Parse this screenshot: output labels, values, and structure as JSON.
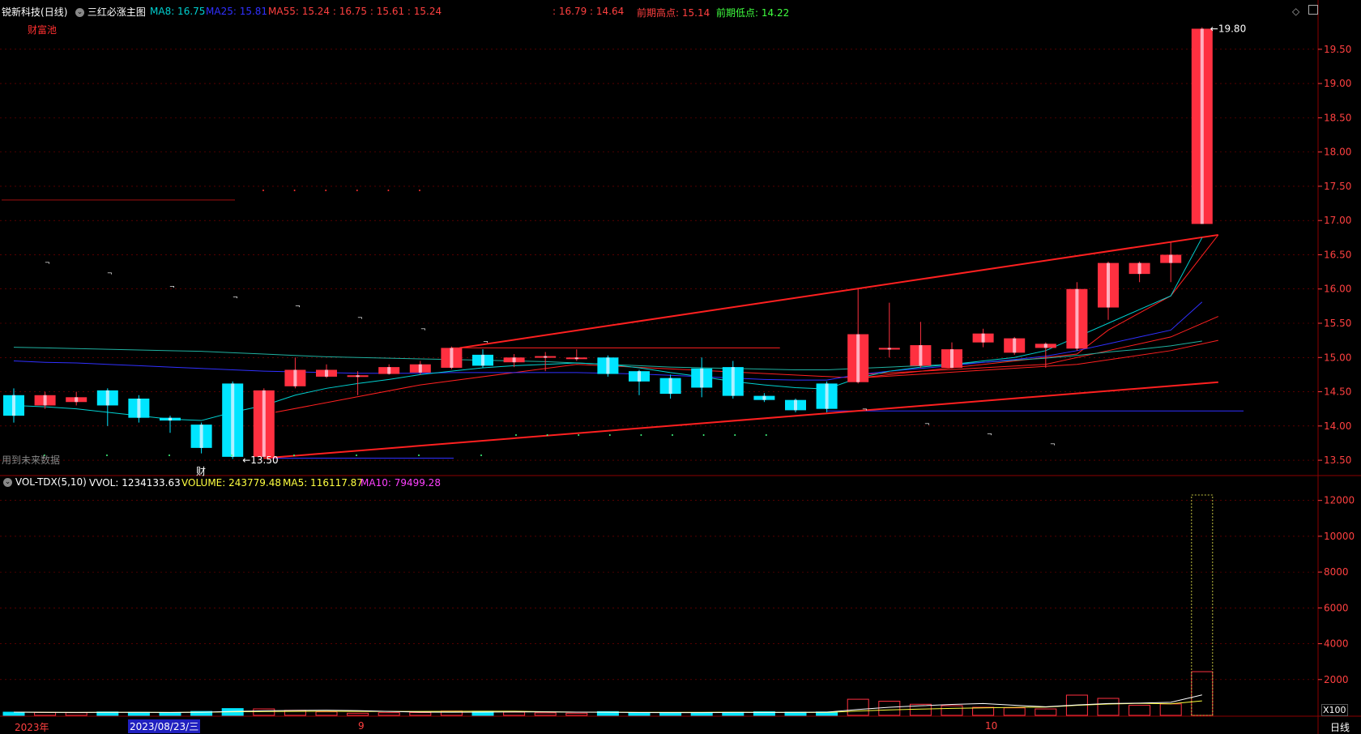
{
  "header": {
    "stock_name": "锐新科技",
    "period": "(日线)",
    "indicator_name": "三红必涨主图",
    "ma8": "MA8: 16.75",
    "ma25": "MA25: 15.81",
    "ma55": "MA55: 15.24 : 16.75 : 15.61 : 15.24",
    "range": ": 16.79 : 14.64",
    "prev_high": "前期高点: 15.14",
    "prev_low": "前期低点: 14.22",
    "caifu": "财富池",
    "future_data": "用到未来数据",
    "cai_marker": "财"
  },
  "volume_header": {
    "name": "VOL-TDX(5,10)",
    "vvol": "VVOL: 1234133.63",
    "volume": "VOLUME: 243779.48",
    "ma5": "MA5: 116117.87",
    "ma10": "MA10: 79499.28"
  },
  "footer": {
    "year_label": "2023年",
    "cursor_date": "2023/08/23/三",
    "month9": "9",
    "month10": "10",
    "period_button": "日线",
    "volume_unit": "X100"
  },
  "annotations": {
    "max_label": "19.80",
    "min_label": "13.50"
  },
  "colors": {
    "up": "#ff3040",
    "down": "#00e5ff",
    "ma8": "#00d0d0",
    "ma25": "#3030ff",
    "ma55": "#20b0a0",
    "grid": "#8b0000",
    "axis_text": "#ff4040",
    "trend": "#ff2020",
    "vol_ma5": "#ffffff",
    "vol_ma10": "#ffff40"
  },
  "chart_data": {
    "type": "candlestick",
    "price_ylim": [
      13.3,
      19.9
    ],
    "price_ticks": [
      "13.50",
      "14.00",
      "14.50",
      "15.00",
      "15.50",
      "16.00",
      "16.50",
      "17.00",
      "17.50",
      "18.00",
      "18.50",
      "19.00",
      "19.50"
    ],
    "volume_ylim": [
      0,
      12800
    ],
    "volume_ticks": [
      "2000",
      "4000",
      "6000",
      "8000",
      "10000",
      "12000"
    ],
    "candles": [
      {
        "o": 14.45,
        "c": 14.15,
        "h": 14.55,
        "l": 14.05,
        "v": 180
      },
      {
        "o": 14.3,
        "c": 14.45,
        "h": 14.5,
        "l": 14.25,
        "v": 160
      },
      {
        "o": 14.35,
        "c": 14.42,
        "h": 14.5,
        "l": 14.3,
        "v": 150
      },
      {
        "o": 14.52,
        "c": 14.3,
        "h": 14.55,
        "l": 14.0,
        "v": 190
      },
      {
        "o": 14.4,
        "c": 14.12,
        "h": 14.45,
        "l": 14.05,
        "v": 170
      },
      {
        "o": 14.12,
        "c": 14.08,
        "h": 14.15,
        "l": 13.9,
        "v": 140
      },
      {
        "o": 14.02,
        "c": 13.68,
        "h": 14.05,
        "l": 13.6,
        "v": 220
      },
      {
        "o": 14.62,
        "c": 13.55,
        "h": 14.65,
        "l": 13.52,
        "v": 380
      },
      {
        "o": 13.55,
        "c": 14.52,
        "h": 14.55,
        "l": 13.52,
        "v": 360
      },
      {
        "o": 14.58,
        "c": 14.82,
        "h": 15.0,
        "l": 14.55,
        "v": 280
      },
      {
        "o": 14.72,
        "c": 14.82,
        "h": 14.9,
        "l": 14.7,
        "v": 200
      },
      {
        "o": 14.72,
        "c": 14.74,
        "h": 14.8,
        "l": 14.45,
        "v": 120
      },
      {
        "o": 14.76,
        "c": 14.86,
        "h": 14.9,
        "l": 14.75,
        "v": 150
      },
      {
        "o": 14.78,
        "c": 14.9,
        "h": 14.95,
        "l": 14.75,
        "v": 160
      },
      {
        "o": 14.85,
        "c": 15.14,
        "h": 15.16,
        "l": 14.83,
        "v": 240
      },
      {
        "o": 15.04,
        "c": 14.88,
        "h": 15.12,
        "l": 14.85,
        "v": 230
      },
      {
        "o": 14.93,
        "c": 15.0,
        "h": 15.05,
        "l": 14.86,
        "v": 180
      },
      {
        "o": 15.0,
        "c": 15.02,
        "h": 15.08,
        "l": 14.8,
        "v": 140
      },
      {
        "o": 14.98,
        "c": 15.0,
        "h": 15.12,
        "l": 14.95,
        "v": 120
      },
      {
        "o": 15.0,
        "c": 14.76,
        "h": 15.03,
        "l": 14.72,
        "v": 210
      },
      {
        "o": 14.8,
        "c": 14.65,
        "h": 14.82,
        "l": 14.45,
        "v": 150
      },
      {
        "o": 14.7,
        "c": 14.47,
        "h": 14.75,
        "l": 14.4,
        "v": 130
      },
      {
        "o": 14.84,
        "c": 14.56,
        "h": 15.0,
        "l": 14.42,
        "v": 160
      },
      {
        "o": 14.86,
        "c": 14.44,
        "h": 14.95,
        "l": 14.4,
        "v": 170
      },
      {
        "o": 14.44,
        "c": 14.38,
        "h": 14.48,
        "l": 14.35,
        "v": 200
      },
      {
        "o": 14.38,
        "c": 14.23,
        "h": 14.4,
        "l": 14.2,
        "v": 180
      },
      {
        "o": 14.62,
        "c": 14.25,
        "h": 14.65,
        "l": 14.2,
        "v": 190
      },
      {
        "o": 14.64,
        "c": 15.34,
        "h": 16.0,
        "l": 14.62,
        "v": 900
      },
      {
        "o": 15.12,
        "c": 15.14,
        "h": 15.8,
        "l": 15.0,
        "v": 790
      },
      {
        "o": 14.88,
        "c": 15.18,
        "h": 15.52,
        "l": 14.85,
        "v": 620
      },
      {
        "o": 14.85,
        "c": 15.12,
        "h": 15.22,
        "l": 14.84,
        "v": 540
      },
      {
        "o": 15.22,
        "c": 15.35,
        "h": 15.42,
        "l": 15.15,
        "v": 450
      },
      {
        "o": 15.07,
        "c": 15.28,
        "h": 15.3,
        "l": 15.04,
        "v": 420
      },
      {
        "o": 15.14,
        "c": 15.2,
        "h": 15.22,
        "l": 14.85,
        "v": 360
      },
      {
        "o": 15.13,
        "c": 16.0,
        "h": 16.1,
        "l": 15.1,
        "v": 1130
      },
      {
        "o": 15.73,
        "c": 16.38,
        "h": 16.4,
        "l": 15.55,
        "v": 950
      },
      {
        "o": 16.22,
        "c": 16.38,
        "h": 16.4,
        "l": 16.1,
        "v": 560
      },
      {
        "o": 16.38,
        "c": 16.5,
        "h": 16.68,
        "l": 16.1,
        "v": 640
      },
      {
        "o": 16.95,
        "c": 19.8,
        "h": 19.82,
        "l": 16.95,
        "v": 2440
      }
    ],
    "volume_ghost": 12300,
    "ma8": [
      14.3,
      14.28,
      14.25,
      14.2,
      14.15,
      14.1,
      14.08,
      14.2,
      14.3,
      14.45,
      14.55,
      14.62,
      14.68,
      14.75,
      14.8,
      14.85,
      14.88,
      14.9,
      14.92,
      14.9,
      14.85,
      14.78,
      14.72,
      14.65,
      14.6,
      14.56,
      14.54,
      14.7,
      14.8,
      14.86,
      14.9,
      14.95,
      15.0,
      15.1,
      15.3,
      15.5,
      15.7,
      15.9,
      16.75
    ],
    "ma25": [
      14.95,
      14.93,
      14.92,
      14.9,
      14.88,
      14.86,
      14.84,
      14.82,
      14.8,
      14.79,
      14.78,
      14.77,
      14.77,
      14.77,
      14.78,
      14.78,
      14.78,
      14.78,
      14.78,
      14.77,
      14.76,
      14.74,
      14.72,
      14.7,
      14.68,
      14.67,
      14.67,
      14.75,
      14.8,
      14.84,
      14.88,
      14.93,
      14.97,
      15.02,
      15.1,
      15.2,
      15.3,
      15.4,
      15.81
    ],
    "ma55": [
      15.15,
      15.14,
      15.13,
      15.12,
      15.11,
      15.1,
      15.09,
      15.07,
      15.05,
      15.03,
      15.01,
      15.0,
      14.99,
      14.98,
      14.97,
      14.96,
      14.95,
      14.94,
      14.92,
      14.9,
      14.88,
      14.86,
      14.85,
      14.84,
      14.83,
      14.82,
      14.82,
      14.84,
      14.86,
      14.88,
      14.9,
      14.93,
      14.96,
      14.99,
      15.03,
      15.08,
      15.12,
      15.17,
      15.24
    ]
  }
}
